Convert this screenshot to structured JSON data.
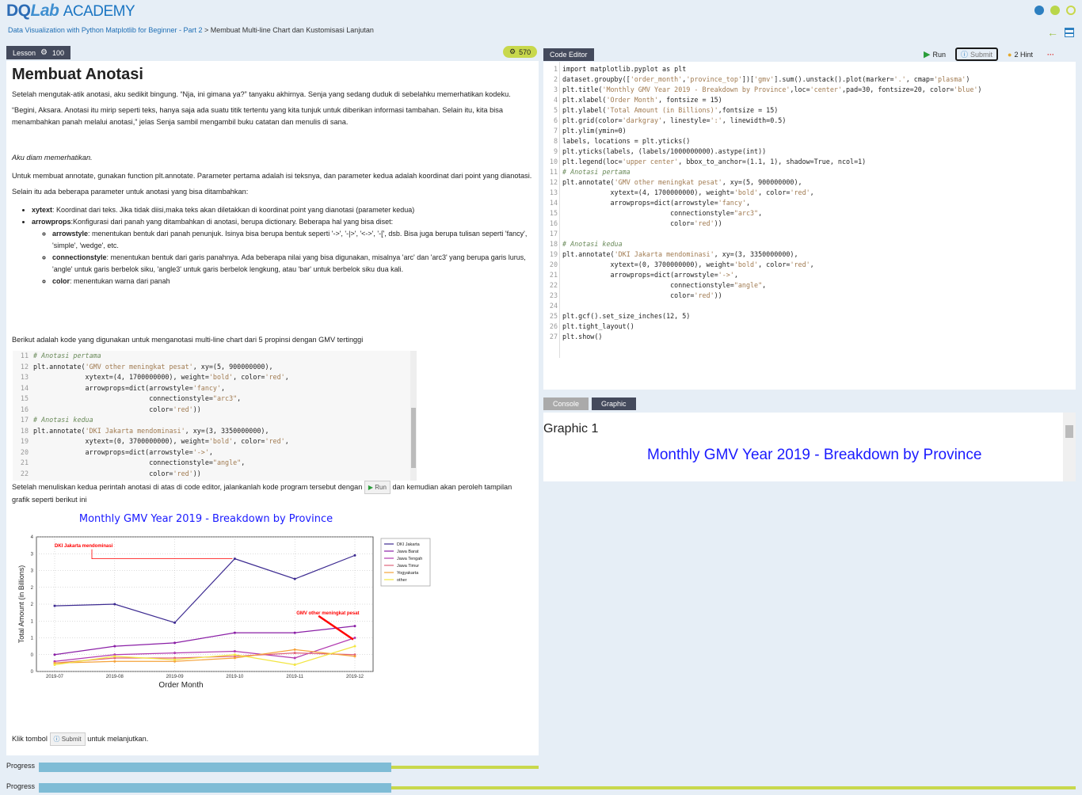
{
  "header": {
    "logo": {
      "d": "DQ",
      "lab": "Lab",
      "academy": "ACADEMY"
    },
    "breadcrumb_link": "Data Visualization with Python Matplotlib for Beginner - Part 2",
    "breadcrumb_sep": " > ",
    "breadcrumb_current": "Membuat Multi-line Chart dan Kustomisasi Lanjutan"
  },
  "lesson_tab": {
    "label": "Lesson",
    "points": "100"
  },
  "gems": "570",
  "lesson": {
    "title": "Membuat Anotasi",
    "p1": "Setelah mengutak-atik anotasi, aku sedikit bingung. “Nja, ini gimana ya?” tanyaku akhirnya. Senja yang sedang duduk di sebelahku memerhatikan kodeku.",
    "p2": "“Begini, Aksara. Anotasi itu mirip seperti teks, hanya saja ada suatu titik tertentu yang kita tunjuk untuk diberikan informasi tambahan. Selain itu, kita bisa menambahkan panah melalui anotasi,” jelas Senja sambil mengambil buku catatan dan menulis di sana.",
    "p3": "Aku diam memerhatikan.",
    "p4": "Untuk membuat annotate, gunakan function  plt.annotate. Parameter pertama adalah isi teksnya, dan parameter kedua adalah koordinat dari point yang dianotasi.",
    "p5": "Selain itu ada beberapa parameter untuk anotasi yang bisa ditambahkan:",
    "b1_key": "xytext",
    "b1_text": ": Koordinat dari teks. Jika tidak diisi,maka teks akan diletakkan di koordinat point yang dianotasi (parameter kedua)",
    "b2_key": "arrowprops",
    "b2_text": ":Konfigurasi dari panah yang ditambahkan di anotasi, berupa dictionary. Beberapa hal yang bisa diset:",
    "s1_key": "arrowstyle",
    "s1_text": ": menentukan bentuk dari panah penunjuk. Isinya bisa berupa bentuk seperti '->', '-|>', '<->', '-[', dsb. Bisa juga berupa tulisan seperti 'fancy', 'simple', 'wedge', etc.",
    "s2_key": "connectionstyle",
    "s2_text": ": menentukan bentuk dari garis panahnya. Ada beberapa nilai yang bisa digunakan, misalnya 'arc' dan 'arc3' yang berupa garis lurus, 'angle' untuk garis berbelok siku, 'angle3' untuk garis berbelok lengkung, atau 'bar' untuk berbelok siku dua kali.",
    "s3_key": "color",
    "s3_text": ": menentukan warna dari panah",
    "p6": "Berikut adalah kode yang digunakan untuk menganotasi multi-line chart dari 5 propinsi dengan GMV tertinggi",
    "p7a": "Setelah menuliskan kedua perintah anotasi di atas di code editor, jalankanlah kode program tersebut dengan",
    "p7_run": "Run",
    "p7b": "dan kemudian akan peroleh tampilan grafik seperti berikut ini",
    "p8a": "Klik tombol",
    "p8_submit": "Submit",
    "p8b": "untuk melanjutkan."
  },
  "snippet": [
    {
      "n": "11",
      "t": "# Anotasi pertama"
    },
    {
      "n": "12",
      "t": "plt.annotate('GMV other meningkat pesat', xy=(5, 900000000),"
    },
    {
      "n": "13",
      "t": "             xytext=(4, 1700000000), weight='bold', color='red',"
    },
    {
      "n": "14",
      "t": "             arrowprops=dict(arrowstyle='fancy',"
    },
    {
      "n": "15",
      "t": "                             connectionstyle=\"arc3\","
    },
    {
      "n": "16",
      "t": "                             color='red'))"
    },
    {
      "n": "17",
      "t": "# Anotasi kedua"
    },
    {
      "n": "18",
      "t": "plt.annotate('DKI Jakarta mendominasi', xy=(3, 3350000000),"
    },
    {
      "n": "19",
      "t": "             xytext=(0, 3700000000), weight='bold', color='red',"
    },
    {
      "n": "20",
      "t": "             arrowprops=dict(arrowstyle='->',"
    },
    {
      "n": "21",
      "t": "                             connectionstyle=\"angle\","
    },
    {
      "n": "22",
      "t": "                             color='red'))"
    }
  ],
  "editor": {
    "tab": "Code Editor",
    "run": "Run",
    "submit": "Submit",
    "hint": "2 Hint",
    "more": "···",
    "lines": [
      {
        "n": "1",
        "t": "import matplotlib.pyplot as plt"
      },
      {
        "n": "2",
        "t": "dataset.groupby(['order_month','province_top'])['gmv'].sum().unstack().plot(marker='.', cmap='plasma')"
      },
      {
        "n": "3",
        "t": "plt.title('Monthly GMV Year 2019 - Breakdown by Province',loc='center',pad=30, fontsize=20, color='blue')"
      },
      {
        "n": "4",
        "t": "plt.xlabel('Order Month', fontsize = 15)"
      },
      {
        "n": "5",
        "t": "plt.ylabel('Total Amount (in Billions)',fontsize = 15)"
      },
      {
        "n": "6",
        "t": "plt.grid(color='darkgray', linestyle=':', linewidth=0.5)"
      },
      {
        "n": "7",
        "t": "plt.ylim(ymin=0)"
      },
      {
        "n": "8",
        "t": "labels, locations = plt.yticks()"
      },
      {
        "n": "9",
        "t": "plt.yticks(labels, (labels/1000000000).astype(int))"
      },
      {
        "n": "10",
        "t": "plt.legend(loc='upper center', bbox_to_anchor=(1.1, 1), shadow=True, ncol=1)"
      },
      {
        "n": "11",
        "t": "# Anotasi pertama"
      },
      {
        "n": "12",
        "t": "plt.annotate('GMV other meningkat pesat', xy=(5, 900000000),"
      },
      {
        "n": "13",
        "t": "            xytext=(4, 1700000000), weight='bold', color='red',"
      },
      {
        "n": "14",
        "t": "            arrowprops=dict(arrowstyle='fancy',"
      },
      {
        "n": "15",
        "t": "                           connectionstyle=\"arc3\","
      },
      {
        "n": "16",
        "t": "                           color='red'))"
      },
      {
        "n": "17",
        "t": ""
      },
      {
        "n": "18",
        "t": "# Anotasi kedua"
      },
      {
        "n": "19",
        "t": "plt.annotate('DKI Jakarta mendominasi', xy=(3, 3350000000),"
      },
      {
        "n": "20",
        "t": "            xytext=(0, 3700000000), weight='bold', color='red',"
      },
      {
        "n": "21",
        "t": "            arrowprops=dict(arrowstyle='->',"
      },
      {
        "n": "22",
        "t": "                           connectionstyle=\"angle\","
      },
      {
        "n": "23",
        "t": "                           color='red'))"
      },
      {
        "n": "24",
        "t": ""
      },
      {
        "n": "25",
        "t": "plt.gcf().set_size_inches(12, 5)"
      },
      {
        "n": "26",
        "t": "plt.tight_layout()"
      },
      {
        "n": "27",
        "t": "plt.show()"
      }
    ]
  },
  "output": {
    "tabs": [
      "Console",
      "Graphic"
    ],
    "active": "Graphic",
    "graphic_label": "Graphic 1",
    "graphic_chart_title": "Monthly GMV Year 2019 - Breakdown by Province"
  },
  "progress": [
    {
      "label": "Progress",
      "fraction": 0.66
    },
    {
      "label": "Progress",
      "fraction": 0.66
    }
  ],
  "colors": {
    "accent": "#444a5c",
    "gem": "#c8d84c",
    "progress": "#7fbcd6",
    "title_blue": "#1a1aff"
  },
  "chart_data": {
    "type": "line",
    "title": "Monthly GMV Year 2019 - Breakdown by Province",
    "xlabel": "Order Month",
    "ylabel": "Total Amount (in Billions)",
    "categories": [
      "2019-07",
      "2019-08",
      "2019-09",
      "2019-10",
      "2019-11",
      "2019-12"
    ],
    "ylim": [
      0,
      4
    ],
    "yticks": [
      "0",
      "0",
      "1",
      "1",
      "2",
      "2",
      "3",
      "3",
      "4"
    ],
    "series": [
      {
        "name": "DKI Jakarta",
        "color": "#3d2b91",
        "values": [
          1.95,
          2.0,
          1.45,
          3.35,
          2.75,
          3.45
        ]
      },
      {
        "name": "Jawa Barat",
        "color": "#8a1fa6",
        "values": [
          0.5,
          0.75,
          0.85,
          1.15,
          1.15,
          1.35
        ]
      },
      {
        "name": "Jawa Tengah",
        "color": "#b23ab0",
        "values": [
          0.3,
          0.5,
          0.55,
          0.6,
          0.4,
          1.0
        ]
      },
      {
        "name": "Jawa Timur",
        "color": "#e0637a",
        "values": [
          0.25,
          0.4,
          0.4,
          0.45,
          0.55,
          0.5
        ]
      },
      {
        "name": "Yogyakarta",
        "color": "#f5a23a",
        "values": [
          0.25,
          0.3,
          0.3,
          0.4,
          0.65,
          0.45
        ]
      },
      {
        "name": "other",
        "color": "#f2e540",
        "values": [
          0.2,
          0.45,
          0.35,
          0.5,
          0.2,
          0.75
        ]
      }
    ],
    "annotations": [
      "DKI Jakarta mendominasi",
      "GMV other meningkat pesat"
    ],
    "annotation_color": "#ff0000",
    "legend": "right",
    "grid": true
  }
}
